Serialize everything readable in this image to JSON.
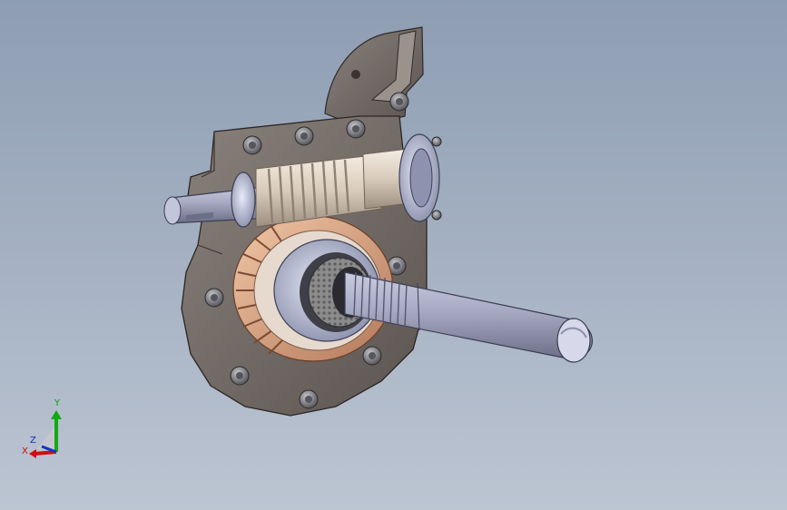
{
  "viewport": {
    "background_top": "#8e9db3",
    "background_bottom": "#bcc5d2"
  },
  "triad": {
    "x_label": "X",
    "y_label": "Y",
    "z_label": "Z",
    "x_color": "#cc1111",
    "y_color": "#11aa11",
    "z_color": "#1133cc"
  },
  "model": {
    "housing_color": "#6e6560",
    "bolt_color": "#8a8a8f",
    "worm_gear_color": "#d9a27e",
    "shaft_color": "#9ea0b8",
    "bearing_color": "#c8cde8"
  }
}
